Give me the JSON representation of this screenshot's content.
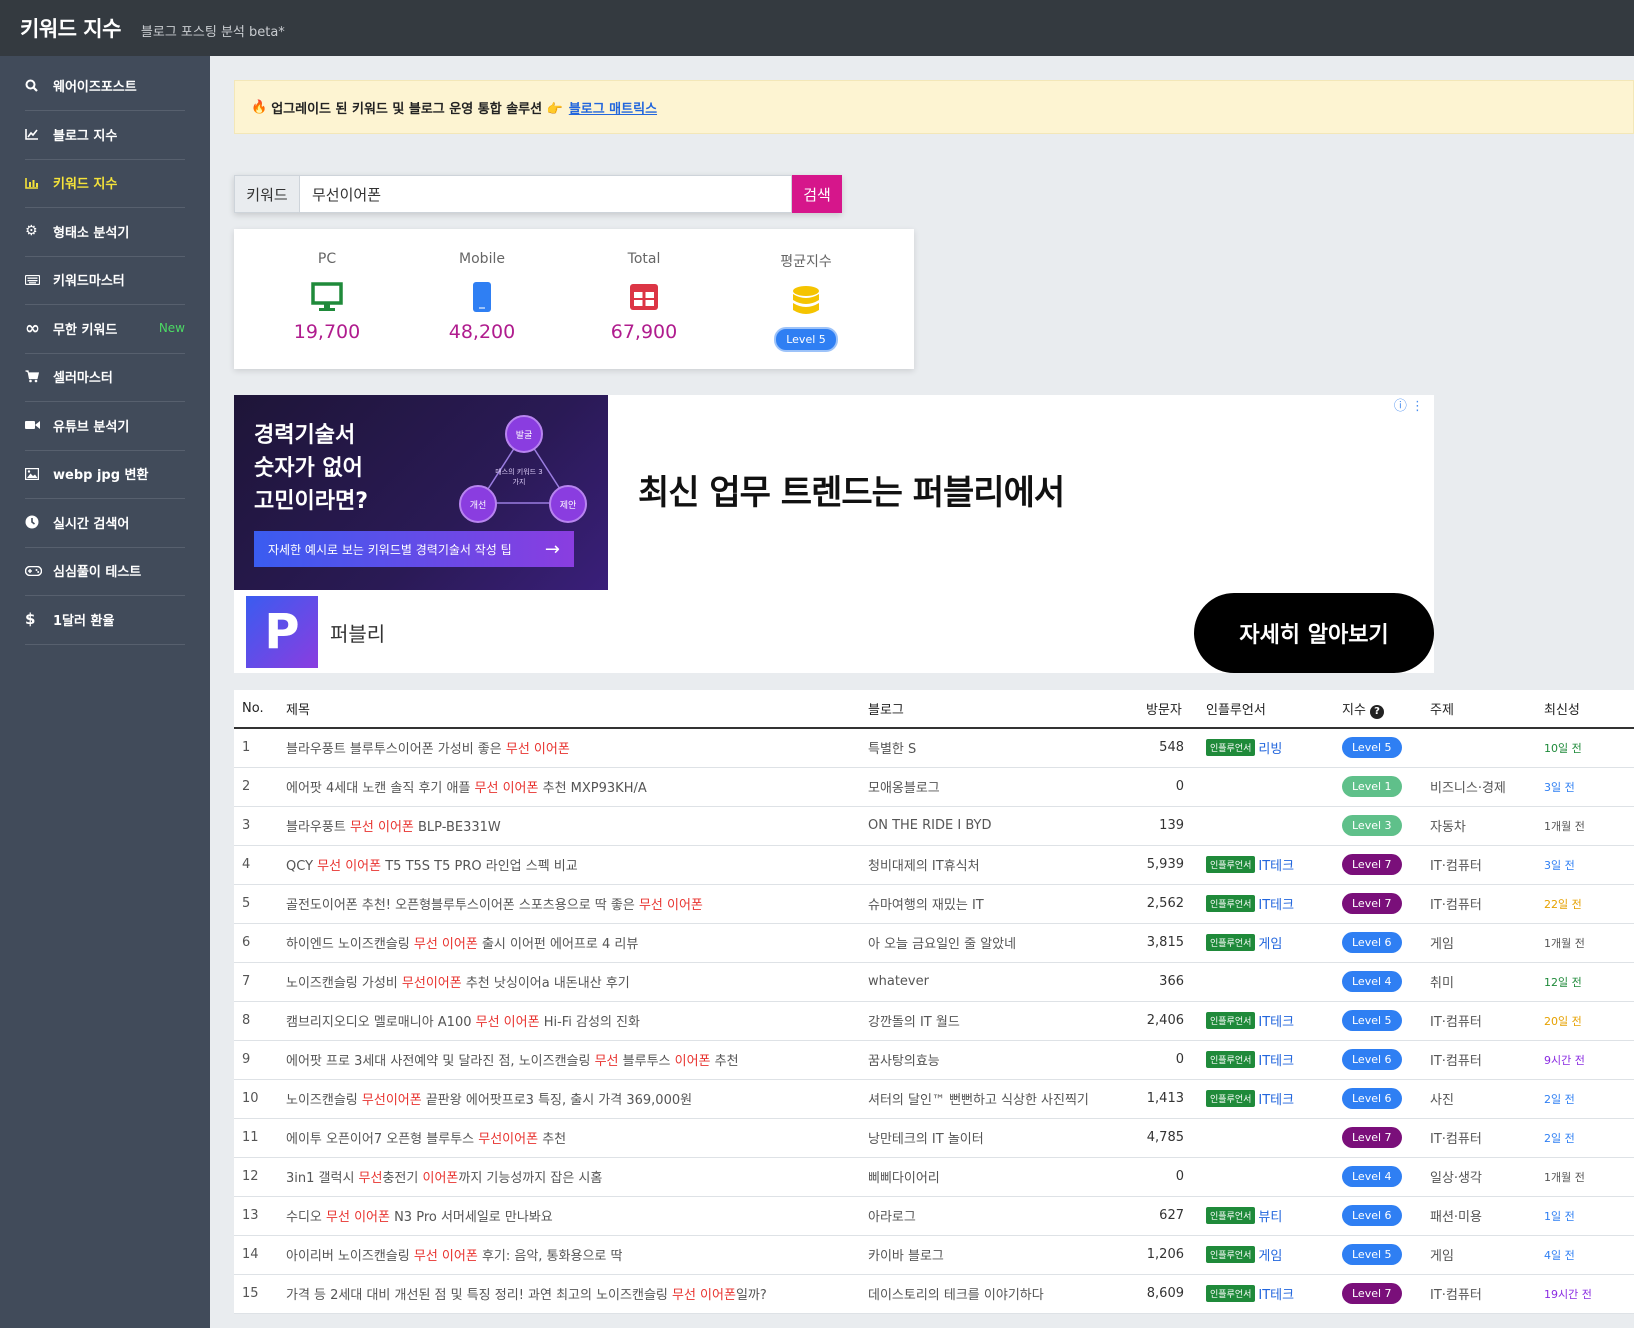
{
  "app": {
    "title": "키워드 지수",
    "subtitle": "블로그 포스팅 분석 beta*"
  },
  "sidebar": {
    "items": [
      {
        "label": "웨어이즈포스트",
        "icon": "search-icon",
        "badge": ""
      },
      {
        "label": "블로그 지수",
        "icon": "area-chart-icon",
        "badge": ""
      },
      {
        "label": "키워드 지수",
        "icon": "bar-chart-icon",
        "badge": "",
        "active": true
      },
      {
        "label": "형태소 분석기",
        "icon": "gear-icon",
        "badge": ""
      },
      {
        "label": "키워드마스터",
        "icon": "keyboard-icon",
        "badge": ""
      },
      {
        "label": "무한 키워드",
        "icon": "infinity-icon",
        "badge": "New"
      },
      {
        "label": "셀러마스터",
        "icon": "cart-icon",
        "badge": ""
      },
      {
        "label": "유튜브 분석기",
        "icon": "video-icon",
        "badge": ""
      },
      {
        "label": "webp jpg 변환",
        "icon": "image-icon",
        "badge": ""
      },
      {
        "label": "실시간 검색어",
        "icon": "clock-icon",
        "badge": ""
      },
      {
        "label": "심심풀이 테스트",
        "icon": "gamepad-icon",
        "badge": ""
      },
      {
        "label": "1달러 환율",
        "icon": "dollar-icon",
        "badge": ""
      }
    ]
  },
  "notice": {
    "text": "업그레이드 된 키워드 및 블로그 운영 통합 솔루션 👉",
    "link": "블로그 매트릭스",
    "icon": "fire-icon"
  },
  "search": {
    "label": "키워드",
    "value": "무선이어폰",
    "button": "검색"
  },
  "stats": {
    "pc": {
      "label": "PC",
      "value": "19,700",
      "icon": "desktop-icon"
    },
    "mobile": {
      "label": "Mobile",
      "value": "48,200",
      "icon": "mobile-icon"
    },
    "total": {
      "label": "Total",
      "value": "67,900",
      "icon": "table-icon"
    },
    "avg": {
      "label": "평균지수",
      "value": "Level 5",
      "icon": "database-icon"
    }
  },
  "ad": {
    "banner_line1": "경력기술서",
    "banner_line2": "숫자가 없어",
    "banner_line3": "고민이라면?",
    "node_top": "발굴",
    "node_left": "개선",
    "node_right": "제안",
    "node_center": "매스의 키워드 3가지",
    "banner_cta": "자세한 예시로 보는 키워드별 경력기술서 작성 팁",
    "headline": "최신 업무 트렌드는 퍼블리에서",
    "logo_letter": "P",
    "brand": "퍼블리",
    "button": "자세히 알아보기"
  },
  "table": {
    "headers": {
      "no": "No.",
      "title": "제목",
      "blog": "블로그",
      "visitors": "방문자",
      "influencer": "인플루언서",
      "index": "지수",
      "topic": "주제",
      "freshness": "최신성"
    },
    "rows": [
      {
        "no": "1",
        "title": [
          [
            "블라우풍트 블루투스이어폰 가성비 좋은 ",
            false
          ],
          [
            "무선 이어폰",
            true
          ]
        ],
        "blog": "특별한 S",
        "visitors": "548",
        "influencer": "리빙",
        "level": "Level 5",
        "level_color": "#2f7ff3",
        "topic": "",
        "fresh": "10일 전",
        "fresh_color": "#1f8a3a"
      },
      {
        "no": "2",
        "title": [
          [
            "에어팟 4세대 노캔 솔직 후기 애플 ",
            false
          ],
          [
            "무선 이어폰",
            true
          ],
          [
            " 추천 MXP93KH/A",
            false
          ]
        ],
        "blog": "모애옹블로그",
        "visitors": "0",
        "influencer": "",
        "level": "Level 1",
        "level_color": "#5fc08a",
        "topic": "비즈니스·경제",
        "fresh": "3일 전",
        "fresh_color": "#2f7ff3"
      },
      {
        "no": "3",
        "title": [
          [
            "블라우풍트 ",
            false
          ],
          [
            "무선 이어폰",
            true
          ],
          [
            " BLP-BE331W",
            false
          ]
        ],
        "blog": "ON THE RIDE I BYD",
        "visitors": "139",
        "influencer": "",
        "level": "Level 3",
        "level_color": "#5fc08a",
        "topic": "자동차",
        "fresh": "1개월 전",
        "fresh_color": "#555555"
      },
      {
        "no": "4",
        "title": [
          [
            "QCY ",
            false
          ],
          [
            "무선 이어폰",
            true
          ],
          [
            " T5 T5S T5 PRO 라인업 스펙 비교",
            false
          ]
        ],
        "blog": "청비대제의 IT휴식처",
        "visitors": "5,939",
        "influencer": "IT테크",
        "level": "Level 7",
        "level_color": "#7a0f7a",
        "topic": "IT·컴퓨터",
        "fresh": "3일 전",
        "fresh_color": "#2f7ff3"
      },
      {
        "no": "5",
        "title": [
          [
            "골전도이어폰 추천! 오픈형블루투스이어폰 스포츠용으로 딱 좋은 ",
            false
          ],
          [
            "무선 이어폰",
            true
          ]
        ],
        "blog": "슈마여행의 재밌는 IT",
        "visitors": "2,562",
        "influencer": "IT테크",
        "level": "Level 7",
        "level_color": "#7a0f7a",
        "topic": "IT·컴퓨터",
        "fresh": "22일 전",
        "fresh_color": "#e6a100"
      },
      {
        "no": "6",
        "title": [
          [
            "하이엔드 노이즈캔슬링 ",
            false
          ],
          [
            "무선 이어폰",
            true
          ],
          [
            " 출시 이어펀 에어프로 4 리뷰",
            false
          ]
        ],
        "blog": "아 오늘 금요일인 줄 알았네",
        "visitors": "3,815",
        "influencer": "게임",
        "level": "Level 6",
        "level_color": "#2f7ff3",
        "topic": "게임",
        "fresh": "1개월 전",
        "fresh_color": "#555555"
      },
      {
        "no": "7",
        "title": [
          [
            "노이즈캔슬링 가성비 ",
            false
          ],
          [
            "무선이어폰",
            true
          ],
          [
            " 추천 낫싱이어a 내돈내산 후기",
            false
          ]
        ],
        "blog": "whatever",
        "visitors": "366",
        "influencer": "",
        "level": "Level 4",
        "level_color": "#2f7ff3",
        "topic": "취미",
        "fresh": "12일 전",
        "fresh_color": "#1f8a3a"
      },
      {
        "no": "8",
        "title": [
          [
            "캠브리지오디오 멜로매니아 A100 ",
            false
          ],
          [
            "무선 이어폰",
            true
          ],
          [
            " Hi-Fi 감성의 진화",
            false
          ]
        ],
        "blog": "강깐돌의 IT 월드",
        "visitors": "2,406",
        "influencer": "IT테크",
        "level": "Level 5",
        "level_color": "#2f7ff3",
        "topic": "IT·컴퓨터",
        "fresh": "20일 전",
        "fresh_color": "#e6a100"
      },
      {
        "no": "9",
        "title": [
          [
            "에어팟 프로 3세대 사전예약 및 달라진 점, 노이즈캔슬링 ",
            false
          ],
          [
            "무선",
            true
          ],
          [
            " 블루투스 ",
            false
          ],
          [
            "이어폰",
            true
          ],
          [
            " 추천",
            false
          ]
        ],
        "blog": "꿈사탕의효능",
        "visitors": "0",
        "influencer": "IT테크",
        "level": "Level 6",
        "level_color": "#2f7ff3",
        "topic": "IT·컴퓨터",
        "fresh": "9시간 전",
        "fresh_color": "#8a2be2"
      },
      {
        "no": "10",
        "title": [
          [
            "노이즈캔슬링 ",
            false
          ],
          [
            "무선이어폰",
            true
          ],
          [
            " 끝판왕 에어팟프로3 특징, 출시 가격 369,000원",
            false
          ]
        ],
        "blog": "셔터의 달인™ 뻔뻔하고 식상한 사진찍기",
        "visitors": "1,413",
        "influencer": "IT테크",
        "level": "Level 6",
        "level_color": "#2f7ff3",
        "topic": "사진",
        "fresh": "2일 전",
        "fresh_color": "#2f7ff3"
      },
      {
        "no": "11",
        "title": [
          [
            "에이투 오픈이어7 오픈형 블루투스 ",
            false
          ],
          [
            "무선이어폰",
            true
          ],
          [
            " 추천",
            false
          ]
        ],
        "blog": "낭만테크의 IT 놀이터",
        "visitors": "4,785",
        "influencer": "",
        "level": "Level 7",
        "level_color": "#7a0f7a",
        "topic": "IT·컴퓨터",
        "fresh": "2일 전",
        "fresh_color": "#2f7ff3"
      },
      {
        "no": "12",
        "title": [
          [
            "3in1 갤럭시 ",
            false
          ],
          [
            "무선",
            true
          ],
          [
            "충전기 ",
            false
          ],
          [
            "이어폰",
            true
          ],
          [
            "까지 기능성까지 잡은 시홈",
            false
          ]
        ],
        "blog": "삐삐다이어리",
        "visitors": "0",
        "influencer": "",
        "level": "Level 4",
        "level_color": "#2f7ff3",
        "topic": "일상·생각",
        "fresh": "1개월 전",
        "fresh_color": "#555555"
      },
      {
        "no": "13",
        "title": [
          [
            "수디오 ",
            false
          ],
          [
            "무선 이어폰",
            true
          ],
          [
            " N3 Pro 서머세일로 만나봐요",
            false
          ]
        ],
        "blog": "아라로그",
        "visitors": "627",
        "influencer": "뷰티",
        "level": "Level 6",
        "level_color": "#2f7ff3",
        "topic": "패션·미용",
        "fresh": "1일 전",
        "fresh_color": "#2f7ff3"
      },
      {
        "no": "14",
        "title": [
          [
            "아이리버 노이즈캔슬링 ",
            false
          ],
          [
            "무선 이어폰",
            true
          ],
          [
            " 후기: 음악, 통화용으로 딱",
            false
          ]
        ],
        "blog": "카이바 블로그",
        "visitors": "1,206",
        "influencer": "게임",
        "level": "Level 5",
        "level_color": "#2f7ff3",
        "topic": "게임",
        "fresh": "4일 전",
        "fresh_color": "#2f7ff3"
      },
      {
        "no": "15",
        "title": [
          [
            "가격 등 2세대 대비 개선된 점 및 특징 정리! 과연 최고의 노이즈캔슬링 ",
            false
          ],
          [
            "무선 이어폰",
            true
          ],
          [
            "일까?",
            false
          ]
        ],
        "blog": "데이스토리의 테크를 이야기하다",
        "visitors": "8,609",
        "influencer": "IT테크",
        "level": "Level 7",
        "level_color": "#7a0f7a",
        "topic": "IT·컴퓨터",
        "fresh": "19시간 전",
        "fresh_color": "#8a2be2"
      }
    ],
    "influencer_badge": "인플루언서"
  }
}
